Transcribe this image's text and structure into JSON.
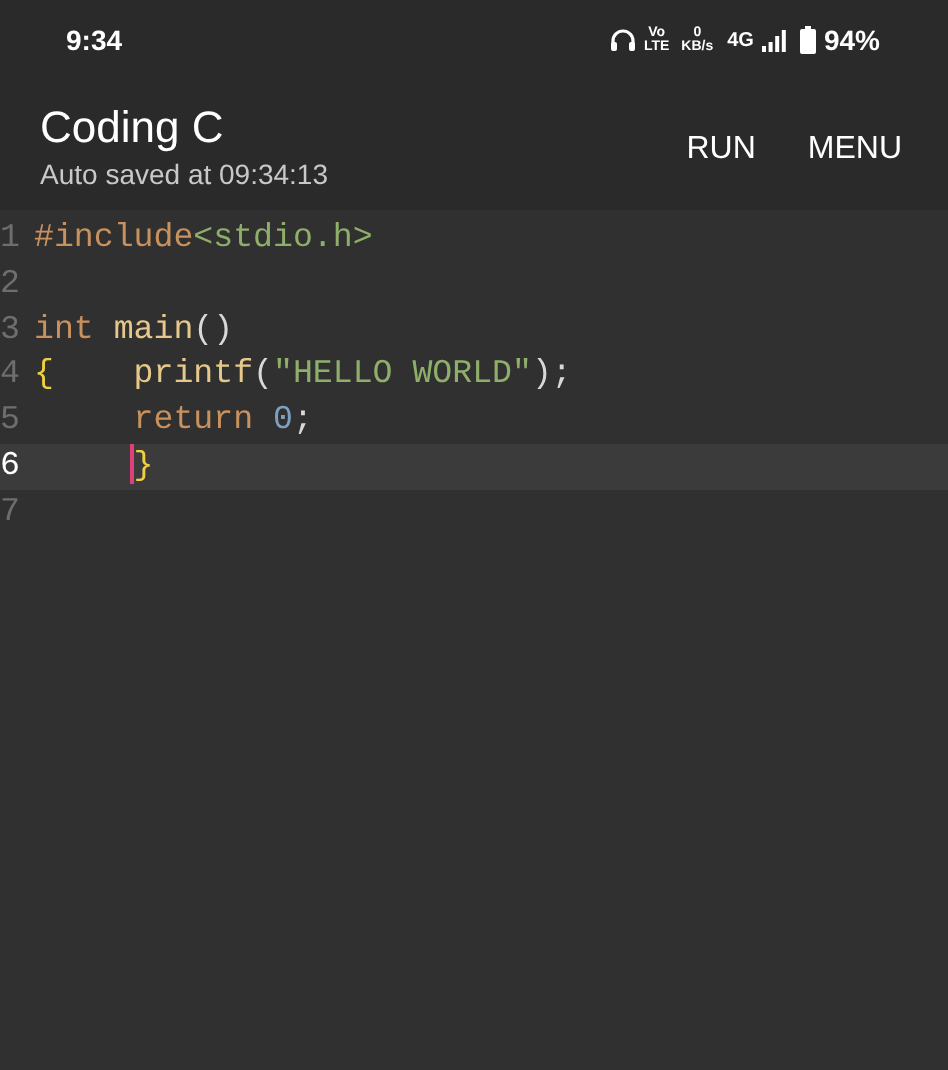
{
  "status_bar": {
    "time": "9:34",
    "volte_top": "Vo",
    "volte_bottom": "LTE",
    "speed_value": "0",
    "speed_unit": "KB/s",
    "network": "4G",
    "battery": "94%"
  },
  "app_bar": {
    "title": "Coding C",
    "subtitle": "Auto saved at 09:34:13",
    "actions": [
      "RUN",
      "MENU"
    ]
  },
  "editor": {
    "lines": [
      {
        "number": "1",
        "selected": false,
        "indented": false,
        "tokens": [
          {
            "text": "#include",
            "kind": "directive"
          },
          {
            "text": "<stdio.h>",
            "kind": "string"
          }
        ]
      },
      {
        "number": "2",
        "selected": false
      },
      {
        "number": "3",
        "selected": false,
        "indented": false,
        "tokens": [
          {
            "text": "int",
            "kind": "keyword"
          },
          {
            "text": "main",
            "kind": "function",
            "space_before": true
          },
          {
            "text": "()",
            "kind": "plain"
          }
        ]
      },
      {
        "number": "4",
        "selected": false,
        "indented": false,
        "tokens": [
          {
            "text": "{",
            "kind": "brace"
          },
          {
            "text": "printf",
            "kind": "function",
            "tab": true
          },
          {
            "text": "(",
            "kind": "plain"
          },
          {
            "text": "\"HELLO WORLD\"",
            "kind": "string"
          },
          {
            "text": ");",
            "kind": "plain"
          }
        ]
      },
      {
        "number": "5",
        "selected": false,
        "indented": true,
        "tokens": [
          {
            "text": "return",
            "kind": "keyword"
          },
          {
            "text": "0",
            "kind": "number",
            "space_before": true
          },
          {
            "text": ";",
            "kind": "plain"
          }
        ]
      },
      {
        "number": "6",
        "selected": true,
        "indented": true,
        "tokens": [
          {
            "text": "}",
            "kind": "brace",
            "cursor": true
          }
        ]
      },
      {
        "number": "7",
        "selected": false
      }
    ]
  }
}
